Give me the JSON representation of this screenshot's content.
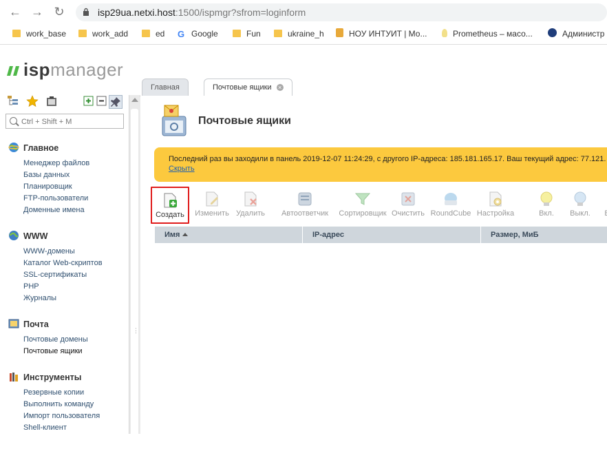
{
  "browser": {
    "url_host": "isp29ua.netxi.host",
    "url_rest": ":1500/ispmgr?sfrom=loginform",
    "bookmarks": [
      {
        "label": "work_base",
        "icon": "folder-icon"
      },
      {
        "label": "work_add",
        "icon": "folder-icon"
      },
      {
        "label": "ed",
        "icon": "folder-icon"
      },
      {
        "label": "Google",
        "icon": "google-icon"
      },
      {
        "label": "Fun",
        "icon": "folder-icon"
      },
      {
        "label": "ukraine_h",
        "icon": "folder-icon"
      },
      {
        "label": "НОУ ИНТУИТ | Мо...",
        "icon": "intuit-icon"
      },
      {
        "label": "Prometheus – масо...",
        "icon": "bulb-icon"
      },
      {
        "label": "Администр",
        "icon": "p-icon"
      }
    ]
  },
  "logo": {
    "prefix": "isp",
    "suffix": "manager"
  },
  "search": {
    "placeholder": "Ctrl + Shift + M"
  },
  "sidebar": {
    "sections": [
      {
        "title": "Главное",
        "icon": "globe-icon",
        "items": [
          "Менеджер файлов",
          "Базы данных",
          "Планировщик",
          "FTP-пользователи",
          "Доменные имена"
        ]
      },
      {
        "title": "WWW",
        "icon": "www-icon",
        "items": [
          "WWW-домены",
          "Каталог Web-скриптов",
          "SSL-сертификаты",
          "PHP",
          "Журналы"
        ]
      },
      {
        "title": "Почта",
        "icon": "mail-icon",
        "items": [
          "Почтовые домены",
          "Почтовые ящики"
        ]
      },
      {
        "title": "Инструменты",
        "icon": "tools-icon",
        "items": [
          "Резервные копии",
          "Выполнить команду",
          "Импорт пользователя",
          "Shell-клиент"
        ]
      }
    ],
    "active_item": "Почтовые ящики"
  },
  "tabs": [
    {
      "label": "Главная"
    },
    {
      "label": "Почтовые ящики"
    }
  ],
  "page": {
    "title": "Почтовые ящики"
  },
  "notice": {
    "text": "Последний раз вы заходили в панель 2019-12-07 11:24:29, с другого IP-адреса: 185.181.165.17. Ваш текущий адрес: 77.121.",
    "hide_link": "Скрыть"
  },
  "toolbar": {
    "buttons": [
      {
        "label": "Создать",
        "icon": "create-icon",
        "enabled": true
      },
      {
        "label": "Изменить",
        "icon": "edit-icon",
        "enabled": false
      },
      {
        "label": "Удалить",
        "icon": "delete-icon",
        "enabled": false
      },
      {
        "label": "Автоответчик",
        "icon": "autoresponder-icon",
        "enabled": false
      },
      {
        "label": "Сортировщик",
        "icon": "filter-icon",
        "enabled": false
      },
      {
        "label": "Очистить",
        "icon": "clear-icon",
        "enabled": false
      },
      {
        "label": "RoundCube",
        "icon": "roundcube-icon",
        "enabled": false
      },
      {
        "label": "Настройка",
        "icon": "settings-icon",
        "enabled": false
      },
      {
        "label": "Вкл.",
        "icon": "bulb-on-icon",
        "enabled": false
      },
      {
        "label": "Выкл.",
        "icon": "bulb-off-icon",
        "enabled": false
      },
      {
        "label": "В",
        "icon": "more-icon",
        "enabled": false
      }
    ]
  },
  "grid": {
    "columns": [
      "Имя",
      "IP-адрес",
      "Размер, МиБ"
    ],
    "sorted_column": "Имя"
  }
}
